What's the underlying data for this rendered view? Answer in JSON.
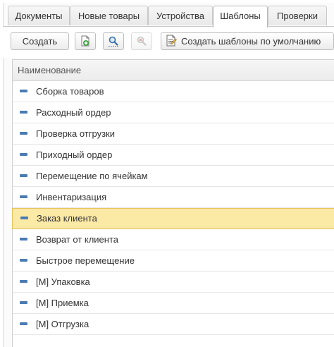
{
  "tabs": [
    {
      "label": "Документы",
      "active": false
    },
    {
      "label": "Новые товары",
      "active": false
    },
    {
      "label": "Устройства",
      "active": false
    },
    {
      "label": "Шаблоны",
      "active": true
    },
    {
      "label": "Проверки",
      "active": false
    }
  ],
  "toolbar": {
    "create_label": "Создать",
    "copy_icon": "add-document-icon",
    "find_icon": "search-icon",
    "cancel_find_icon": "search-cancel-icon",
    "create_defaults_label": "Создать шаблоны по умолчанию",
    "create_defaults_icon": "document-icon"
  },
  "table": {
    "column_header": "Наименование",
    "rows": [
      "Сборка товаров",
      "Расходный ордер",
      "Проверка отгрузки",
      "Приходный ордер",
      "Перемещение по ячейкам",
      "Инвентаризация",
      "Заказ клиента",
      "Возврат от клиента",
      "Быстрое перемещение",
      "[М] Упаковка",
      "[М] Приемка",
      "[М] Отгрузка"
    ],
    "selected_row": "Заказ клиента"
  },
  "colors": {
    "selected_row_bg": "#fbe9a6",
    "selected_row_border": "#e5c35c",
    "row_marker": "#4a7bb3"
  }
}
